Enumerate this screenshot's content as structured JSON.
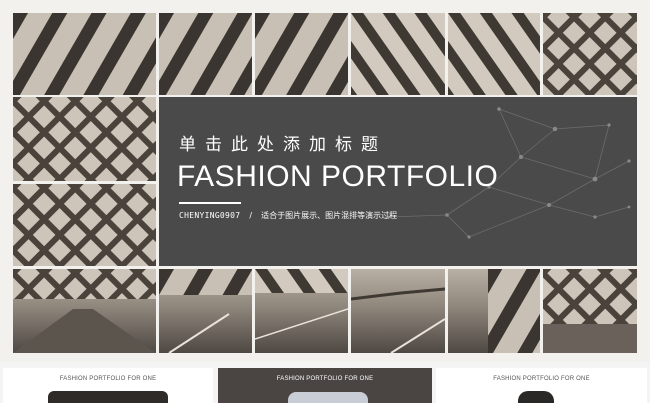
{
  "slide": {
    "title_cn": "单击此处添加标题",
    "title_en": "FASHION PORTFOLIO",
    "subtitle_code": "CHENYING0907",
    "subtitle_sep": "/",
    "subtitle_desc": "适合于图片展示、图片混排等演示过程"
  },
  "thumbnails": [
    {
      "label": "FASHION PORTFOLIO FOR ONE"
    },
    {
      "label": "FASHION PORTFOLIO FOR ONE"
    },
    {
      "label": "FASHION PORTFOLIO FOR ONE"
    }
  ],
  "colors": {
    "panel": "#4b4a4a",
    "photo_tone": "#8a8178",
    "slide_background": "#f3f1ee"
  }
}
